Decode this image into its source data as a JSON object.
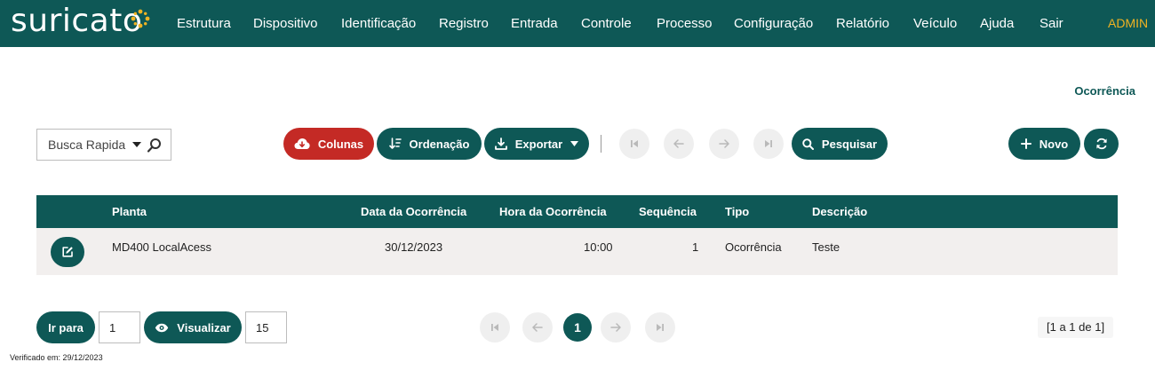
{
  "app": {
    "logo_text": "suricato",
    "brand_colors": {
      "primary": "#0e5856",
      "danger": "#c42a25",
      "accent": "#f0b323"
    }
  },
  "nav": {
    "items": [
      "Estrutura",
      "Dispositivo",
      "Identificação",
      "Registro",
      "Entrada",
      "Controle",
      "Processo",
      "Configuração",
      "Relatório",
      "Veículo",
      "Ajuda",
      "Sair"
    ],
    "user": "ADMIN"
  },
  "page": {
    "title": "Ocorrência"
  },
  "search": {
    "placeholder": "Busca Rapida",
    "icons": [
      "caret-down-icon",
      "search-icon"
    ]
  },
  "toolbar": {
    "columns_label": "Colunas",
    "sort_label": "Ordenação",
    "export_label": "Exportar",
    "search_label": "Pesquisar",
    "new_label": "Novo",
    "nav_icons": [
      "first-page-icon",
      "prev-page-icon",
      "next-page-icon",
      "last-page-icon"
    ],
    "refresh_icon": "refresh-icon"
  },
  "table": {
    "headers": [
      "Planta",
      "Data da Ocorrência",
      "Hora da Ocorrência",
      "Sequência",
      "Tipo",
      "Descrição"
    ],
    "rows": [
      {
        "planta": "MD400 LocalAcess",
        "data": "30/12/2023",
        "hora": "10:00",
        "sequencia": "1",
        "tipo": "Ocorrência",
        "descricao": "Teste"
      }
    ]
  },
  "pagination": {
    "goto_label": "Ir para",
    "goto_value": "1",
    "view_label": "Visualizar",
    "page_size": "15",
    "current_page": "1",
    "range_text": "[1 a 1 de 1]"
  },
  "footer": {
    "verified_text": "Verificado em: 29/12/2023"
  }
}
